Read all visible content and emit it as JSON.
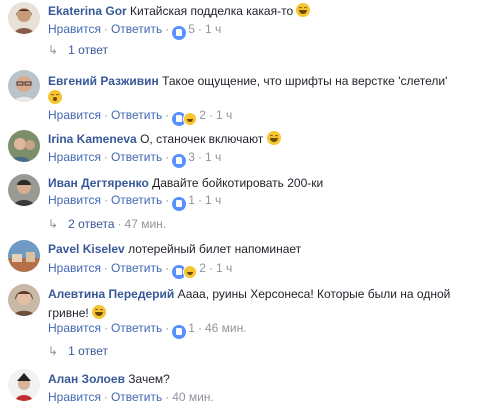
{
  "comments": [
    {
      "name": "Ekaterina Gor",
      "text": "Китайская подделка какая-то",
      "emoji": "grin",
      "like": "Нравится",
      "reply": "Ответить",
      "reactions": [
        "like"
      ],
      "reaction_count": "5",
      "time": "1 ч",
      "replies": {
        "label": "1 ответ",
        "time": ""
      }
    },
    {
      "name": "Евгений Разживин",
      "text": "Такое ощущение, что шрифты на верстке 'слетели'",
      "emoji": "wow",
      "like": "Нравится",
      "reply": "Ответить",
      "reactions": [
        "like",
        "haha"
      ],
      "reaction_count": "2",
      "time": "1 ч"
    },
    {
      "name": "Irina Kameneva",
      "text": "О, станочек включают",
      "emoji": "grin",
      "like": "Нравится",
      "reply": "Ответить",
      "reactions": [
        "like"
      ],
      "reaction_count": "3",
      "time": "1 ч"
    },
    {
      "name": "Иван Дегтяренко",
      "text": "Давайте бойкотировать 200-ки",
      "like": "Нравится",
      "reply": "Ответить",
      "reactions": [
        "like"
      ],
      "reaction_count": "1",
      "time": "1 ч",
      "replies": {
        "label": "2 ответа",
        "time": "47 мин."
      }
    },
    {
      "name": "Pavel Kiselev",
      "text": "лотерейный билет напоминает",
      "like": "Нравится",
      "reply": "Ответить",
      "reactions": [
        "like",
        "haha"
      ],
      "reaction_count": "2",
      "time": "1 ч"
    },
    {
      "name": "Алевтина Передерий",
      "text": "Аааа, руины Херсонеса! Которые были на одной",
      "text2": "гривне!",
      "emoji": "grin",
      "like": "Нравится",
      "reply": "Ответить",
      "reactions": [
        "like"
      ],
      "reaction_count": "1",
      "time": "46 мин.",
      "replies": {
        "label": "1 ответ",
        "time": ""
      }
    },
    {
      "name": "Алан Золоев",
      "text": "Зачем?",
      "like": "Нравится",
      "reply": "Ответить",
      "reactions": [],
      "reaction_count": "",
      "time": "40 мин."
    }
  ],
  "colors": {
    "name": "#385898",
    "link": "#4267b2",
    "meta": "#90949c"
  }
}
